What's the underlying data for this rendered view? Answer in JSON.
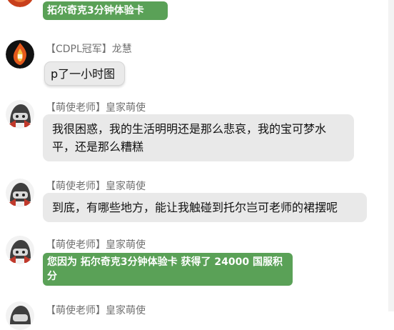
{
  "messages": [
    {
      "id": "m0",
      "sender": "",
      "text": "拓尔奇克3分钟体验卡",
      "kind": "system-green",
      "avatar": "red-avatar-icon"
    },
    {
      "id": "m1",
      "sender": "【CDPL冠军】龙慧",
      "text": "p了一小时图",
      "kind": "plain",
      "avatar": "fire-emblem-avatar-icon"
    },
    {
      "id": "m2",
      "sender": "【萌使老师】皇家萌使",
      "text": "我很困惑，我的生活明明还是那么悲哀，我的宝可梦水平，还是那么糟糕",
      "kind": "normal",
      "avatar": "helmet-avatar-icon"
    },
    {
      "id": "m3",
      "sender": "【萌使老师】皇家萌使",
      "text": "到底，有哪些地方，能让我触碰到托尔岂可老师的裙摆呢",
      "kind": "normal",
      "avatar": "helmet-avatar-icon"
    },
    {
      "id": "m4",
      "sender": "【萌使老师】皇家萌使",
      "text": "您因为 拓尔奇克3分钟体验卡 获得了 24000 国服积分",
      "kind": "system-green",
      "avatar": "helmet-avatar-icon"
    },
    {
      "id": "m5",
      "sender": "【萌使老师】皇家萌使",
      "text": "",
      "kind": "normal",
      "avatar": "helmet-avatar-icon"
    }
  ],
  "colors": {
    "green_bubble": "#5aa157",
    "gray_bubble": "#e9e9e9",
    "sender_text": "#707070"
  }
}
